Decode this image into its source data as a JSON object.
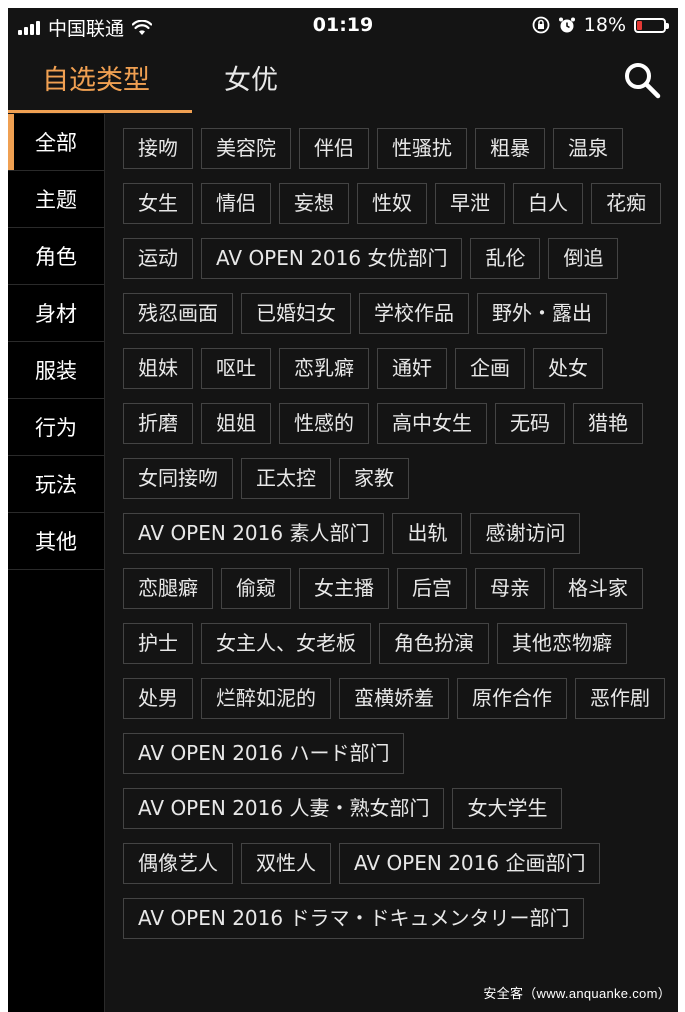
{
  "status_bar": {
    "carrier": "中国联通",
    "time": "01:19",
    "battery": "18%",
    "battery_level": 0.18,
    "icons": [
      "signal-icon",
      "wifi-icon",
      "orientation-lock-icon",
      "alarm-icon",
      "battery-icon"
    ]
  },
  "nav": {
    "tabs": [
      {
        "label": "自选类型",
        "active": true
      },
      {
        "label": "女优",
        "active": false
      }
    ],
    "search_icon": "search-icon"
  },
  "colors": {
    "accent": "#f0a052",
    "background": "#141414",
    "sidebar_bg": "#000000",
    "tag_border": "#444444",
    "battery_low": "#e53935"
  },
  "sidebar": {
    "items": [
      {
        "label": "全部",
        "active": true
      },
      {
        "label": "主题",
        "active": false
      },
      {
        "label": "角色",
        "active": false
      },
      {
        "label": "身材",
        "active": false
      },
      {
        "label": "服装",
        "active": false
      },
      {
        "label": "行为",
        "active": false
      },
      {
        "label": "玩法",
        "active": false
      },
      {
        "label": "其他",
        "active": false
      }
    ]
  },
  "tags": [
    "接吻",
    "美容院",
    "伴侣",
    "性骚扰",
    "粗暴",
    "温泉",
    "女生",
    "情侣",
    "妄想",
    "性奴",
    "早泄",
    "白人",
    "花痴",
    "运动",
    "AV OPEN 2016 女优部门",
    "乱伦",
    "倒追",
    "残忍画面",
    "已婚妇女",
    "学校作品",
    "野外・露出",
    "姐妹",
    "呕吐",
    "恋乳癖",
    "通奸",
    "企画",
    "处女",
    "折磨",
    "姐姐",
    "性感的",
    "高中女生",
    "无码",
    "猎艳",
    "女同接吻",
    "正太控",
    "家教",
    "AV OPEN 2016 素人部门",
    "出轨",
    "感谢访问",
    "恋腿癖",
    "偷窥",
    "女主播",
    "后宫",
    "母亲",
    "格斗家",
    "护士",
    "女主人、女老板",
    "角色扮演",
    "其他恋物癖",
    "处男",
    "烂醉如泥的",
    "蛮横娇羞",
    "原作合作",
    "恶作剧",
    "AV OPEN 2016 ハード部门",
    "AV OPEN 2016 人妻・熟女部门",
    "女大学生",
    "偶像艺人",
    "双性人",
    "AV OPEN 2016 企画部门",
    "AV OPEN 2016 ドラマ・ドキュメンタリー部门"
  ],
  "watermark": "安全客（www.anquanke.com）"
}
